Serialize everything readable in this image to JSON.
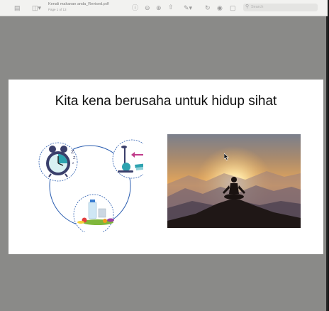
{
  "window": {
    "document_name": "Kenali makanan anda_Revised.pdf",
    "page_indicator": "Page 1 of 13"
  },
  "toolbar": {
    "search_placeholder": "Search"
  },
  "slide": {
    "title": "Kita kena berusaha untuk hidup sihat"
  },
  "colors": {
    "viewer_background": "#8a8a88",
    "cycle_circle": "#2a5db0"
  }
}
